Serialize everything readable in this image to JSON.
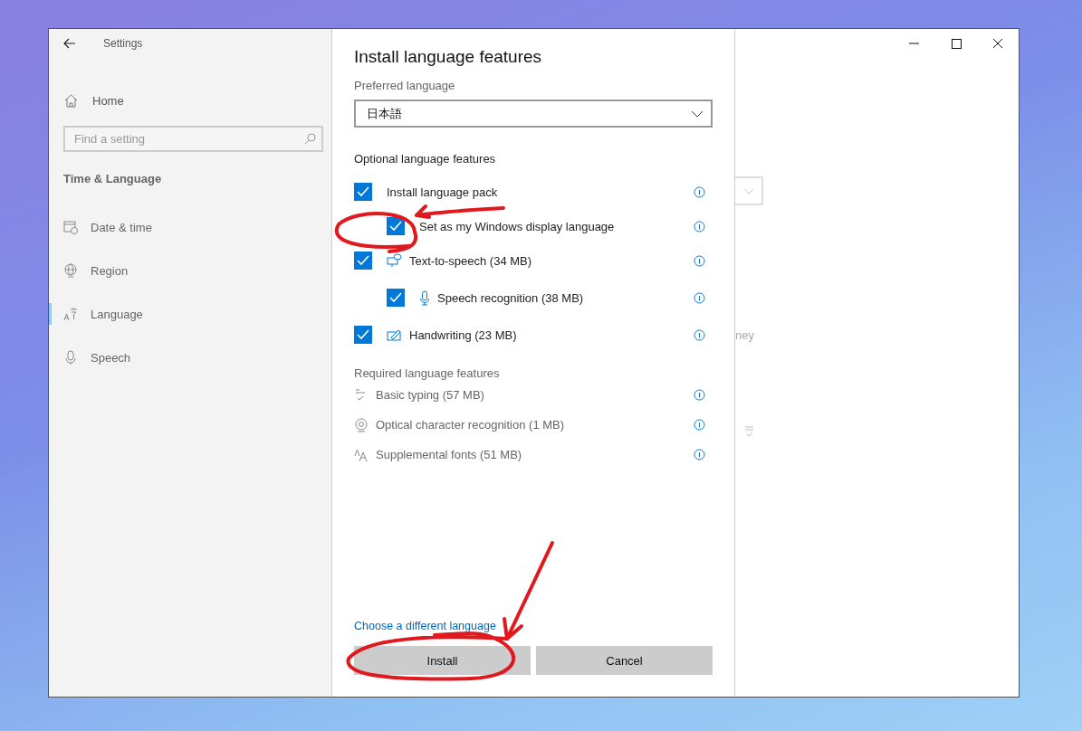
{
  "window": {
    "title": "Settings"
  },
  "sidebar": {
    "home": "Home",
    "search": {
      "placeholder": "Find a setting"
    },
    "section": "Time & Language",
    "items": [
      {
        "label": "Date & time",
        "selected": false
      },
      {
        "label": "Region",
        "selected": false
      },
      {
        "label": "Language",
        "selected": true
      },
      {
        "label": "Speech",
        "selected": false
      }
    ]
  },
  "dialog": {
    "title": "Install language features",
    "preferred_label": "Preferred language",
    "preferred_value": "日本語",
    "optional_heading": "Optional language features",
    "optional": [
      {
        "label": "Install language pack",
        "checked": true,
        "children": [
          {
            "label": "Set as my Windows display language",
            "checked": true
          }
        ]
      },
      {
        "label": "Text-to-speech (34 MB)",
        "checked": true,
        "children": [
          {
            "label": "Speech recognition (38 MB)",
            "checked": true
          }
        ]
      },
      {
        "label": "Handwriting (23 MB)",
        "checked": true
      }
    ],
    "required_heading": "Required language features",
    "required": [
      "Basic typing (57 MB)",
      "Optical character recognition (1 MB)",
      "Supplemental fonts (51 MB)"
    ],
    "link": "Choose a different language",
    "buttons": [
      "Install",
      "Cancel"
    ]
  },
  "background_page": {
    "text": "ney"
  }
}
